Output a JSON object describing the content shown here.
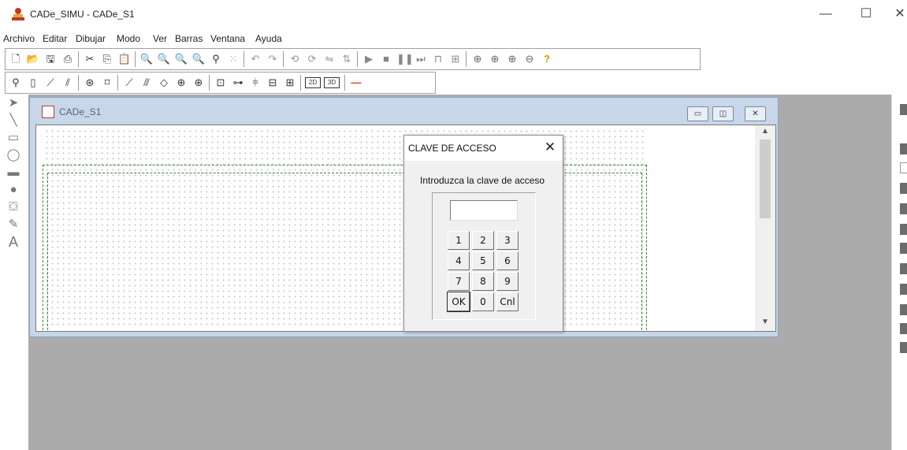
{
  "window": {
    "title": "CADe_SIMU - CADe_S1",
    "icon": "app-logo-icon",
    "controls": {
      "minimize": "—",
      "maximize": "☐",
      "close": "✕"
    }
  },
  "menu": [
    "Archivo",
    "Editar",
    "Dibujar",
    "Modo",
    "Ver",
    "Barras",
    "Ventana",
    "Ayuda"
  ],
  "toolbar_standard": [
    "new-file-icon",
    "open-folder-icon",
    "save-icon",
    "print-icon",
    "cut-icon",
    "copy-icon",
    "paste-icon",
    "zoom-page-icon",
    "zoom-window-icon",
    "zoom-in-icon",
    "zoom-out-icon",
    "search-icon",
    "grid-icon",
    "undo-icon",
    "redo-icon",
    "rotate-left-icon",
    "rotate-right-icon",
    "mirror-icon",
    "flip-icon",
    "play-icon",
    "stop-icon",
    "pause-icon",
    "step-icon",
    "chart-icon",
    "io-icon",
    "zoom-all-icon",
    "zoom-prev-icon",
    "zoom-plus-icon",
    "zoom-minus-icon",
    "help-icon"
  ],
  "toolbar_components": {
    "items": [
      "supply-icon",
      "fuse-icon",
      "switch-icon",
      "relay-contacts-icon",
      "motor-icon",
      "coil-icon",
      "contact-no-icon",
      "contact-nc-icon",
      "diode-icon",
      "lamp-icon",
      "terminal-icon",
      "timer-icon",
      "resistor-icon",
      "capacitor-icon",
      "plc-io-icon",
      "bus-icon"
    ],
    "label_2d": "2D",
    "label_3d": "3D"
  },
  "left_tools": [
    "select-arrow-icon",
    "line-icon",
    "rectangle-icon",
    "ellipse-icon",
    "filled-rectangle-icon",
    "filled-ellipse-icon",
    "fill-icon",
    "pen-icon",
    "text-icon"
  ],
  "child_window": {
    "title": "CADe_S1",
    "controls": {
      "minimize": "▭",
      "maximize": "◫",
      "close": "✕"
    }
  },
  "dialog": {
    "title": "CLAVE DE ACCESO",
    "close": "✕",
    "prompt": "Introduzca la clave de acceso",
    "password_value": "",
    "keys": [
      "1",
      "2",
      "3",
      "4",
      "5",
      "6",
      "7",
      "8",
      "9",
      "OK",
      "0",
      "Cnl"
    ]
  },
  "colors": {
    "workspace": "#ababab",
    "frame_line": "#2c8a2c",
    "child_frame": "#c7d6e9",
    "dialog_bg": "#f0f0f0"
  }
}
